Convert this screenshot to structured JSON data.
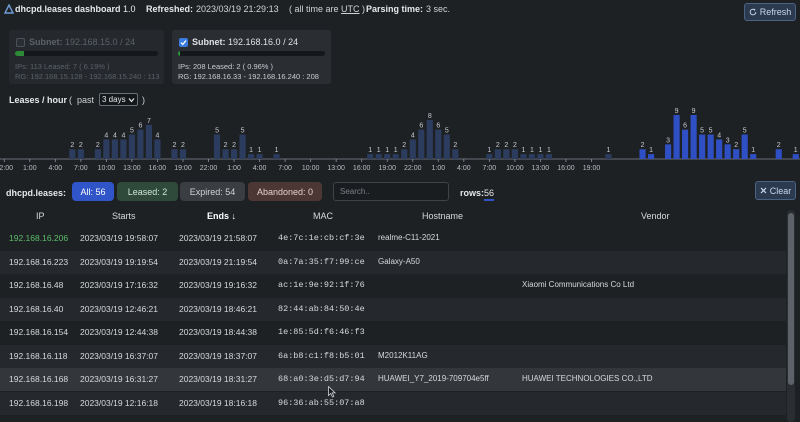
{
  "header": {
    "app_name": "dhcpd.leases dashboard",
    "version": "1.0",
    "refreshed_label": "Refreshed:",
    "refreshed_value": "2023/03/19 21:29:13",
    "time_note_prefix": "( all time are",
    "time_note_tz": "UTC",
    "time_note_suffix": ")",
    "parsing_label": "Parsing time:",
    "parsing_value": "3 sec.",
    "refresh_label": "Refresh",
    "refresh_icon": "refresh-icon"
  },
  "subnets": [
    {
      "checked": false,
      "label": "Subnet:",
      "cidr": "192.168.15.0 / 24",
      "usage_fraction": 0.0619,
      "line1": "IPs: 113  Leased: 7 ( 6.19% )",
      "line2": "RG: 192.168.15.128 - 192.168.15.240 : 113"
    },
    {
      "checked": true,
      "label": "Subnet:",
      "cidr": "192.168.16.0 / 24",
      "usage_fraction": 0.0096,
      "line1": "IPs: 208  Leased: 2 ( 0.96% )",
      "line2": "RG: 192.168.16.33 - 192.168.16.240 : 208"
    }
  ],
  "histogram": {
    "title": "Leases / hour",
    "paren_open": "(",
    "past_label": "past",
    "range_value": "3 days",
    "paren_close": ")",
    "colors": {
      "dim": "#2c3c5e",
      "bright": "#2f4fc4",
      "axis": "#8a9096"
    }
  },
  "chart_data": {
    "type": "bar",
    "title": "Leases / hour",
    "x_tick_labels": [
      "22:00",
      "1:00",
      "4:00",
      "7:00",
      "10:00",
      "13:00",
      "16:00",
      "19:00",
      "22:00",
      "1:00",
      "4:00",
      "7:00",
      "10:00",
      "13:00",
      "16:00",
      "19:00",
      "22:00",
      "1:00",
      "4:00",
      "7:00",
      "10:00",
      "13:00",
      "16:00",
      "19:00"
    ],
    "values": [
      0,
      0,
      0,
      0,
      0,
      0,
      0,
      0,
      2,
      2,
      0,
      2,
      4,
      4,
      4,
      5,
      6,
      7,
      4,
      0,
      2,
      2,
      0,
      0,
      0,
      5,
      2,
      2,
      5,
      1,
      1,
      0,
      1,
      0,
      0,
      0,
      0,
      0,
      0,
      0,
      0,
      0,
      0,
      1,
      1,
      1,
      1,
      2,
      4,
      6,
      8,
      6,
      5,
      2,
      0,
      0,
      0,
      1,
      2,
      2,
      2,
      1,
      1,
      1,
      1,
      0,
      0,
      0,
      0,
      0,
      0,
      1,
      0,
      0,
      0,
      2,
      1,
      0,
      3,
      9,
      6,
      9,
      5,
      5,
      4,
      3,
      2,
      5,
      1,
      0,
      0,
      2,
      0,
      1
    ],
    "bright_from_index": 72,
    "ylim": [
      0,
      9
    ]
  },
  "filters": {
    "label": "dhcpd.leases:",
    "buttons": [
      {
        "label": "All: 56"
      },
      {
        "label": "Leased: 2"
      },
      {
        "label": "Expired: 54"
      },
      {
        "label": "Abandoned: 0"
      }
    ],
    "search_placeholder": "Search..",
    "rows_label": "rows:",
    "rows_value": "56",
    "clear_label": "Clear",
    "clear_icon": "close-icon"
  },
  "table": {
    "columns": [
      "IP",
      "Starts",
      "Ends",
      "MAC",
      "Hostname",
      "Vendor"
    ],
    "sort_arrow": "↓",
    "rows": [
      {
        "ip": "192.168.16.206",
        "starts": "2023/03/19 19:58:07",
        "ends": "2023/03/19 21:58:07",
        "mac": "4e:7c:1e:cb:cf:3e",
        "hostname": "realme-C11-2021",
        "vendor": ""
      },
      {
        "ip": "192.168.16.223",
        "starts": "2023/03/19 19:19:54",
        "ends": "2023/03/19 21:19:54",
        "mac": "0a:7a:35:f7:99:ce",
        "hostname": "Galaxy-A50",
        "vendor": ""
      },
      {
        "ip": "192.168.16.48",
        "starts": "2023/03/19 17:16:32",
        "ends": "2023/03/19 19:16:32",
        "mac": "ac:1e:9e:92:1f:76",
        "hostname": "",
        "vendor": "Xiaomi Communications Co Ltd"
      },
      {
        "ip": "192.168.16.40",
        "starts": "2023/03/19 12:46:21",
        "ends": "2023/03/19 18:46:21",
        "mac": "82:44:ab:84:50:4e",
        "hostname": "",
        "vendor": ""
      },
      {
        "ip": "192.168.16.154",
        "starts": "2023/03/19 12:44:38",
        "ends": "2023/03/19 18:44:38",
        "mac": "1e:85:5d:f6:46:f3",
        "hostname": "",
        "vendor": ""
      },
      {
        "ip": "192.168.16.118",
        "starts": "2023/03/19 16:37:07",
        "ends": "2023/03/19 18:37:07",
        "mac": "6a:b8:c1:f8:b5:01",
        "hostname": "M2012K11AG",
        "vendor": ""
      },
      {
        "ip": "192.168.16.168",
        "starts": "2023/03/19 16:31:27",
        "ends": "2023/03/19 18:31:27",
        "mac": "68:a0:3e:d5:d7:94",
        "hostname": "HUAWEI_Y7_2019-709704e5ff",
        "vendor": "HUAWEI TECHNOLOGIES CO.,LTD"
      },
      {
        "ip": "192.168.16.198",
        "starts": "2023/03/19 12:16:18",
        "ends": "2023/03/19 18:16:18",
        "mac": "96:36:ab:55:07:a8",
        "hostname": "",
        "vendor": ""
      }
    ]
  }
}
